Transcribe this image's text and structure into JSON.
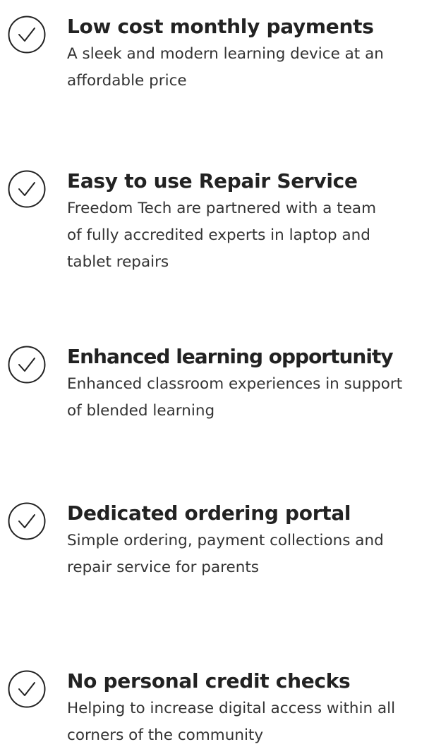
{
  "colors": {
    "text": "#222222",
    "icon_stroke": "#222222"
  },
  "features": [
    {
      "icon": "check-circle-icon",
      "title": "Low cost monthly payments",
      "description": "A sleek and modern learning device at an affordable price"
    },
    {
      "icon": "check-circle-icon",
      "title": "Easy to use Repair Service",
      "description": "Freedom Tech are partnered with a team of fully accredited experts in laptop and tablet repairs"
    },
    {
      "icon": "check-circle-icon",
      "title": "Enhanced learning opportunity",
      "description": "Enhanced classroom experiences in support of blended learning"
    },
    {
      "icon": "check-circle-icon",
      "title": "Dedicated ordering portal",
      "description": "Simple ordering, payment collections and repair service for parents"
    },
    {
      "icon": "check-circle-icon",
      "title": "No personal credit checks",
      "description": "Helping to increase digital access within all corners of the community"
    }
  ]
}
